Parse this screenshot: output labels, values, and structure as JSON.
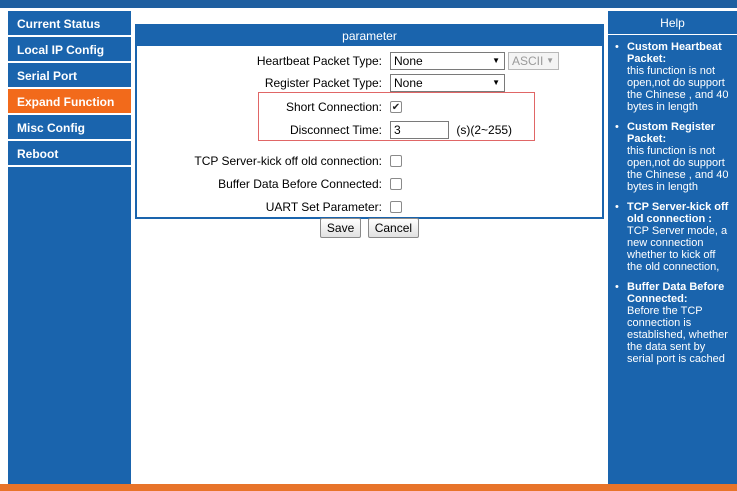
{
  "sidebar": {
    "items": [
      {
        "label": "Current Status"
      },
      {
        "label": "Local IP Config"
      },
      {
        "label": "Serial Port"
      },
      {
        "label": "Expand Function"
      },
      {
        "label": "Misc Config"
      },
      {
        "label": "Reboot"
      }
    ],
    "active_index": 3
  },
  "parameter": {
    "header": "parameter",
    "heartbeat": {
      "label": "Heartbeat Packet Type:",
      "value": "None",
      "format_value": "ASCII"
    },
    "register": {
      "label": "Register Packet Type:",
      "value": "None"
    },
    "short_connection": {
      "label": "Short Connection:",
      "checked": true
    },
    "disconnect_time": {
      "label": "Disconnect Time:",
      "value": "3",
      "suffix": "(s)(2~255)"
    },
    "kick_off": {
      "label": "TCP Server-kick off old connection:",
      "checked": false
    },
    "buffer_data": {
      "label": "Buffer Data Before Connected:",
      "checked": false
    },
    "uart_set": {
      "label": "UART Set Parameter:",
      "checked": false
    }
  },
  "buttons": {
    "save": "Save",
    "cancel": "Cancel"
  },
  "help": {
    "header": "Help",
    "items": [
      {
        "title": "Custom Heartbeat Packet:",
        "text": "this function is not open,not do support the Chinese , and 40 bytes in length"
      },
      {
        "title": "Custom Register Packet:",
        "text": "this function is not open,not do support the Chinese , and 40 bytes in length"
      },
      {
        "title": "TCP Server-kick off old connection :",
        "text": "TCP Server mode, a new connection whether to kick off the old connection,"
      },
      {
        "title": "Buffer Data Before Connected:",
        "text": "Before the TCP connection is established, whether the data sent by serial port is cached"
      }
    ]
  },
  "colors": {
    "nav_bg": "#1a64ad",
    "active": "#f26a1b",
    "accent_bottom": "#e8742a",
    "highlight_border": "#e06666"
  }
}
